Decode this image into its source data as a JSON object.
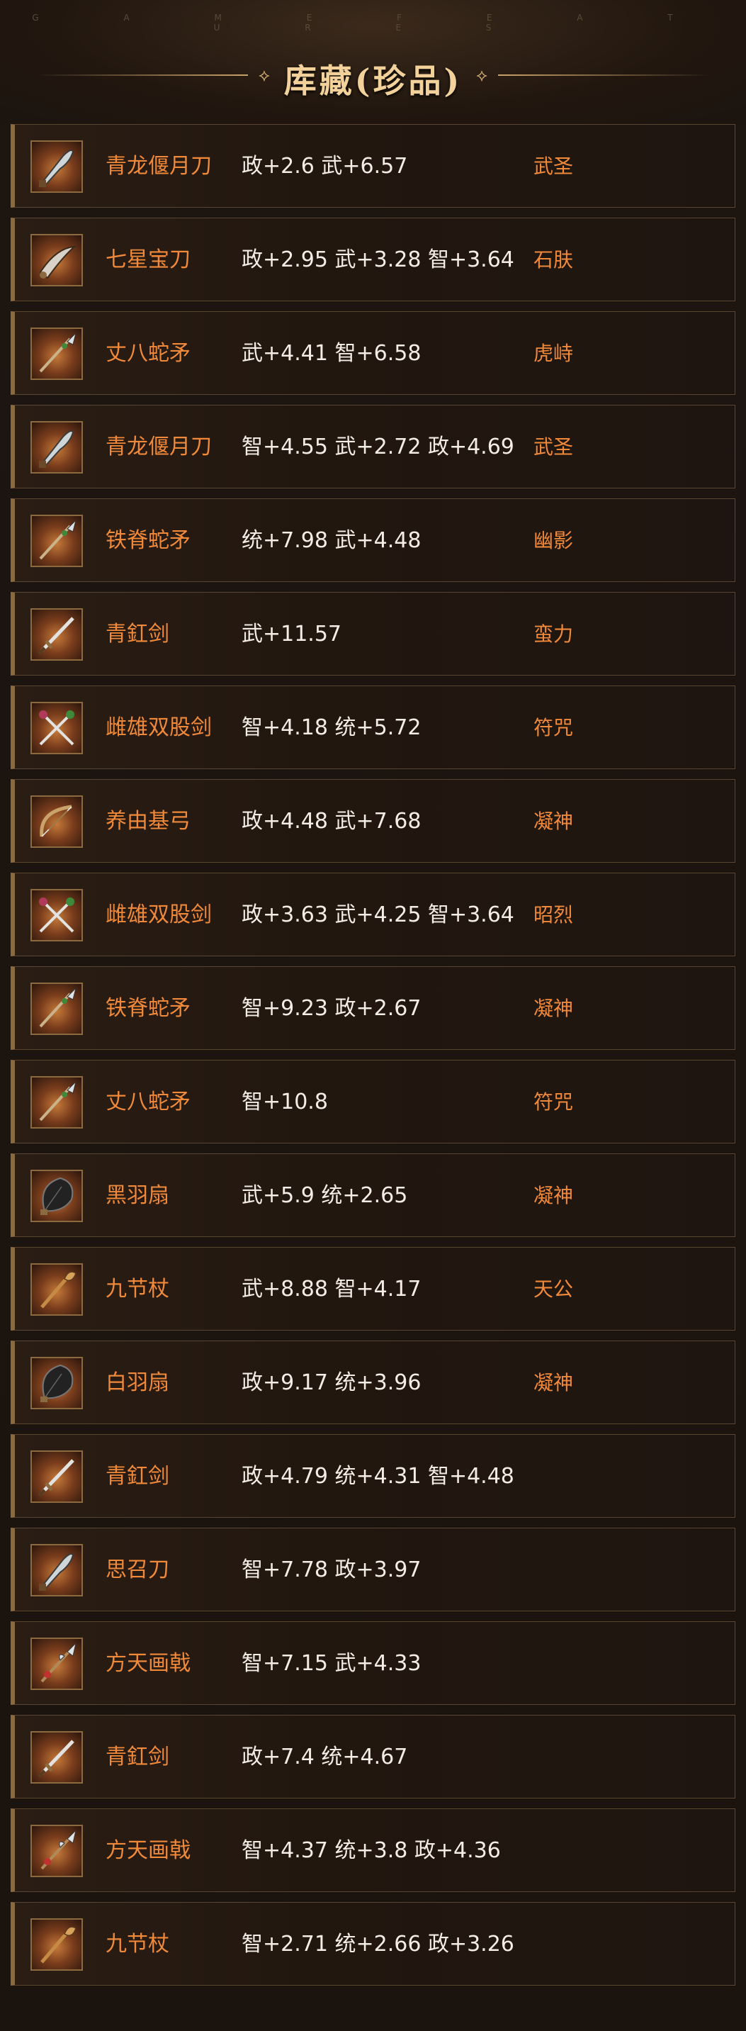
{
  "header": {
    "subtitle": "G A M E   F E A T U R E S",
    "title": "库藏(珍品)",
    "ornament_left": "⟡",
    "ornament_right": "⟡"
  },
  "colors": {
    "name": "#f0893a",
    "stats": "#f3ede6",
    "title": "#f2d29a",
    "row_border": "#5a4533"
  },
  "items": [
    {
      "icon": "blade-icon",
      "name": "青龙偃月刀",
      "stats": "政+2.6 武+6.57",
      "tag": "武圣"
    },
    {
      "icon": "saber-icon",
      "name": "七星宝刀",
      "stats": "政+2.95 武+3.28 智+3.64",
      "tag": "石肤"
    },
    {
      "icon": "spear-icon",
      "name": "丈八蛇矛",
      "stats": "武+4.41 智+6.58",
      "tag": "虎峙"
    },
    {
      "icon": "blade-icon",
      "name": "青龙偃月刀",
      "stats": "智+4.55 武+2.72 政+4.69",
      "tag": "武圣"
    },
    {
      "icon": "spear-icon",
      "name": "铁脊蛇矛",
      "stats": "统+7.98 武+4.48",
      "tag": "幽影"
    },
    {
      "icon": "sword-icon",
      "name": "青釭剑",
      "stats": "武+11.57",
      "tag": "蛮力"
    },
    {
      "icon": "twin-swords-icon",
      "name": "雌雄双股剑",
      "stats": "智+4.18 统+5.72",
      "tag": "符咒"
    },
    {
      "icon": "bow-icon",
      "name": "养由基弓",
      "stats": "政+4.48 武+7.68",
      "tag": "凝神"
    },
    {
      "icon": "twin-swords-icon",
      "name": "雌雄双股剑",
      "stats": "政+3.63 武+4.25 智+3.64",
      "tag": "昭烈"
    },
    {
      "icon": "spear-icon",
      "name": "铁脊蛇矛",
      "stats": "智+9.23 政+2.67",
      "tag": "凝神"
    },
    {
      "icon": "spear-icon",
      "name": "丈八蛇矛",
      "stats": "智+10.8",
      "tag": "符咒"
    },
    {
      "icon": "fan-icon",
      "name": "黑羽扇",
      "stats": "武+5.9 统+2.65",
      "tag": "凝神"
    },
    {
      "icon": "staff-icon",
      "name": "九节杖",
      "stats": "武+8.88 智+4.17",
      "tag": "天公"
    },
    {
      "icon": "fan-icon",
      "name": "白羽扇",
      "stats": "政+9.17 统+3.96",
      "tag": "凝神"
    },
    {
      "icon": "sword-icon",
      "name": "青釭剑",
      "stats": "政+4.79 统+4.31 智+4.48",
      "tag": ""
    },
    {
      "icon": "blade-icon",
      "name": "思召刀",
      "stats": "智+7.78 政+3.97",
      "tag": ""
    },
    {
      "icon": "halberd-icon",
      "name": "方天画戟",
      "stats": "智+7.15 武+4.33",
      "tag": ""
    },
    {
      "icon": "sword-icon",
      "name": "青釭剑",
      "stats": "政+7.4 统+4.67",
      "tag": ""
    },
    {
      "icon": "halberd-icon",
      "name": "方天画戟",
      "stats": "智+4.37 统+3.8 政+4.36",
      "tag": ""
    },
    {
      "icon": "staff-icon",
      "name": "九节杖",
      "stats": "智+2.71 统+2.66 政+3.26",
      "tag": ""
    }
  ]
}
